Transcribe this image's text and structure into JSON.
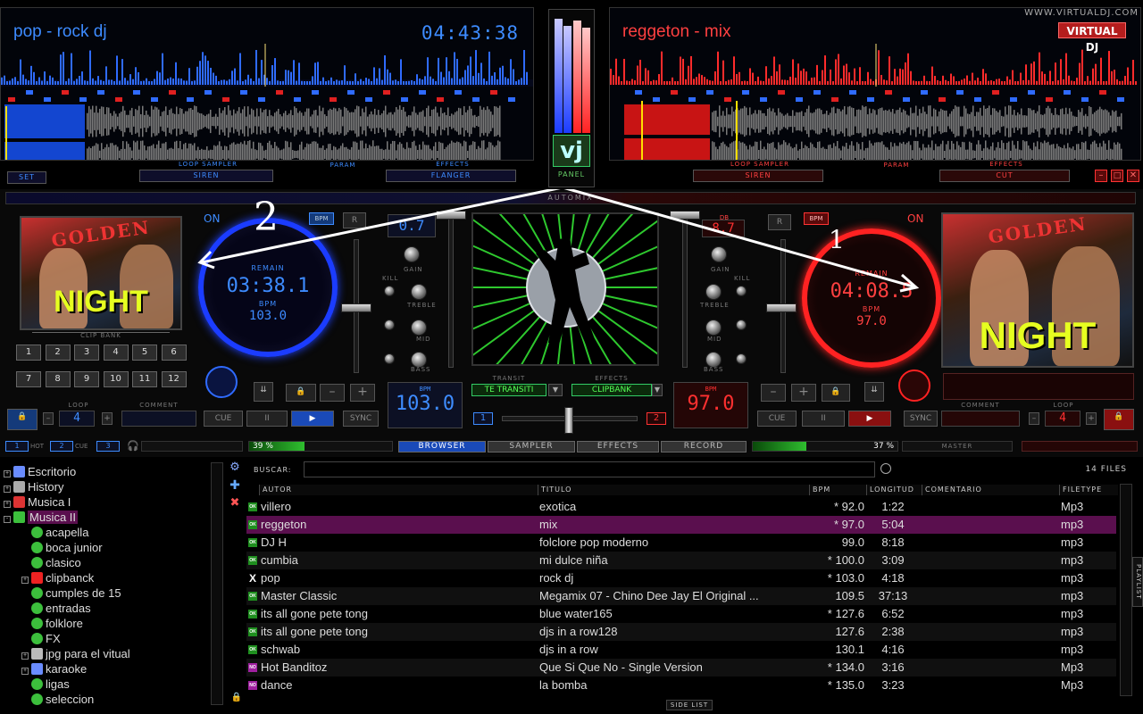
{
  "brand_text": "WWW.VIRTUALDJ.COM",
  "logo_text": "VIRTUAL DJ",
  "deck_left": {
    "title": "pop - rock dj",
    "clock": "04:43:38",
    "remain_label": "REMAIN",
    "remain_time": "03:38.1",
    "bpm_label": "BPM",
    "bpm_value": "103.0",
    "bpm_display": "103.0",
    "pitch": "0.7",
    "loop_sampler_label": "LOOP SAMPLER",
    "sampler_value": "SIREN",
    "param_label": "PARAM",
    "effects_label": "EFFECTS",
    "effect_value": "FLANGER",
    "set_label": "SET",
    "on_label": "ON",
    "clip_bank_label": "CLIP BANK",
    "clip_buttons": [
      "1",
      "2",
      "3",
      "4",
      "5",
      "6",
      "7",
      "8",
      "9",
      "10",
      "11",
      "12"
    ],
    "loop_label": "LOOP",
    "loop_value": "4",
    "comment_label": "COMMENT",
    "cue_label": "CUE",
    "pause_label": "II",
    "play_label": "▶",
    "sync_label": "SYNC",
    "hot_cue_1": "1",
    "hot_cue_2": "2",
    "hot_cue_3": "3",
    "cue_tag": "CUE",
    "hot_tag": "HOT",
    "volume_percent": "39 %",
    "volume_fraction": 0.39,
    "r_label": "R",
    "bpm_btn": "BPM"
  },
  "deck_right": {
    "title": "reggeton - mix",
    "remain_label": "REMAIN",
    "remain_time": "04:08.5",
    "bpm_label": "BPM",
    "bpm_value": "97.0",
    "bpm_display": "97.0",
    "pitch": "8.7",
    "loop_sampler_label": "LOOP SAMPLER",
    "sampler_value": "SIREN",
    "param_label": "PARAM",
    "effects_label": "EFFECTS",
    "effect_value": "CUT",
    "on_label": "ON",
    "loop_label": "LOOP",
    "loop_value": "4",
    "comment_label": "COMMENT",
    "cue_label": "CUE",
    "pause_label": "II",
    "play_label": "▶",
    "sync_label": "SYNC",
    "volume_percent": "37 %",
    "volume_fraction": 0.37,
    "r_label": "R",
    "bpm_btn": "BPM",
    "master_label": "MASTER"
  },
  "mixer": {
    "automix_label": "AUTOMIX",
    "gain": "GAIN",
    "kill": "KILL",
    "treble": "TREBLE",
    "mid": "MID",
    "bass": "BASS",
    "transition_label": "TRANSIT",
    "transition_value": "TE TRANSITI",
    "effects_label": "EFFECTS",
    "effects_value": "CLIPBANK",
    "cross_left": "1",
    "cross_right": "2",
    "panel_label": "PANEL",
    "vj_label": "vj",
    "db_label": "DB"
  },
  "annotations": {
    "one": "1",
    "two": "2"
  },
  "tabs": {
    "browser": "BROWSER",
    "sampler": "SAMPLER",
    "effects": "EFFECTS",
    "record": "RECORD"
  },
  "tree": [
    {
      "label": "Escritorio",
      "expander": "+",
      "indent": 0,
      "icon": "desktop-icon",
      "color": "#6a8cff"
    },
    {
      "label": "History",
      "expander": "+",
      "indent": 0,
      "icon": "history-icon",
      "color": "#aaaaaa"
    },
    {
      "label": "Musica I",
      "expander": "+",
      "indent": 0,
      "icon": "music-folder-icon",
      "color": "#d33"
    },
    {
      "label": "Musica II",
      "expander": "-",
      "indent": 0,
      "icon": "music-folder-icon",
      "color": "#3cbf3c",
      "selected": true
    },
    {
      "label": "acapella",
      "expander": "",
      "indent": 1,
      "icon": "play-folder-icon",
      "color": "#3cbf3c"
    },
    {
      "label": "boca junior",
      "expander": "",
      "indent": 1,
      "icon": "play-folder-icon",
      "color": "#3cbf3c"
    },
    {
      "label": "clasico",
      "expander": "",
      "indent": 1,
      "icon": "play-folder-icon",
      "color": "#3cbf3c"
    },
    {
      "label": "clipbanck",
      "expander": "+",
      "indent": 1,
      "icon": "forbidden-icon",
      "color": "#e22"
    },
    {
      "label": "cumples de 15",
      "expander": "",
      "indent": 1,
      "icon": "play-folder-icon",
      "color": "#3cbf3c"
    },
    {
      "label": "entradas",
      "expander": "",
      "indent": 1,
      "icon": "play-folder-icon",
      "color": "#3cbf3c"
    },
    {
      "label": "folklore",
      "expander": "",
      "indent": 1,
      "icon": "play-folder-icon",
      "color": "#3cbf3c"
    },
    {
      "label": "FX",
      "expander": "",
      "indent": 1,
      "icon": "play-folder-icon",
      "color": "#3cbf3c"
    },
    {
      "label": "jpg para el vitual",
      "expander": "+",
      "indent": 1,
      "icon": "camera-icon",
      "color": "#bbbbbb"
    },
    {
      "label": "karaoke",
      "expander": "+",
      "indent": 1,
      "icon": "note-icon",
      "color": "#6a8cff"
    },
    {
      "label": "ligas",
      "expander": "",
      "indent": 1,
      "icon": "play-folder-icon",
      "color": "#3cbf3c"
    },
    {
      "label": "seleccion",
      "expander": "",
      "indent": 1,
      "icon": "play-folder-icon",
      "color": "#3cbf3c"
    }
  ],
  "browser": {
    "search_label": "BUSCAR:",
    "search_value": "",
    "files_count": "14 FILES",
    "side_list": "SIDE LIST",
    "playlist_tab": "PLAYLIST",
    "columns": [
      "AUTOR",
      "TITULO",
      "BPM",
      "LONGITUD",
      "COMENTARIO",
      "FILETYPE"
    ],
    "rows": [
      {
        "badge": "OK",
        "autor": "villero",
        "titulo": "exotica",
        "bpm": "* 92.0",
        "longitud": "1:22",
        "comentario": "",
        "filetype": "Mp3"
      },
      {
        "badge": "OK",
        "autor": "reggeton",
        "titulo": "mix",
        "bpm": "* 97.0",
        "longitud": "5:04",
        "comentario": "",
        "filetype": "mp3",
        "highlight": "purple"
      },
      {
        "badge": "OK",
        "autor": "DJ H",
        "titulo": "folclore pop moderno",
        "bpm": "99.0",
        "longitud": "8:18",
        "comentario": "",
        "filetype": "mp3"
      },
      {
        "badge": "OK",
        "autor": "cumbia",
        "titulo": "mi dulce niña",
        "bpm": "* 100.0",
        "longitud": "3:09",
        "comentario": "",
        "filetype": "mp3"
      },
      {
        "badge": "X",
        "autor": "pop",
        "titulo": "rock dj",
        "bpm": "* 103.0",
        "longitud": "4:18",
        "comentario": "",
        "filetype": "mp3"
      },
      {
        "badge": "OK",
        "autor": "Master Classic",
        "titulo": "Megamix 07 - Chino Dee Jay El Original ...",
        "bpm": "109.5",
        "longitud": "37:13",
        "comentario": "",
        "filetype": "mp3"
      },
      {
        "badge": "OK",
        "autor": "its all gone pete tong",
        "titulo": "blue water165",
        "bpm": "* 127.6",
        "longitud": "6:52",
        "comentario": "",
        "filetype": "mp3"
      },
      {
        "badge": "OK",
        "autor": "its all gone pete tong",
        "titulo": "djs in a row128",
        "bpm": "127.6",
        "longitud": "2:38",
        "comentario": "",
        "filetype": "mp3"
      },
      {
        "badge": "OK",
        "autor": "schwab",
        "titulo": "djs in a row",
        "bpm": "130.1",
        "longitud": "4:16",
        "comentario": "",
        "filetype": "mp3"
      },
      {
        "badge": "NO",
        "autor": "Hot Banditoz",
        "titulo": "Que Si Que No - Single Version",
        "bpm": "* 134.0",
        "longitud": "3:16",
        "comentario": "",
        "filetype": "Mp3"
      },
      {
        "badge": "NO",
        "autor": "dance",
        "titulo": "la bomba",
        "bpm": "* 135.0",
        "longitud": "3:23",
        "comentario": "",
        "filetype": "Mp3"
      }
    ]
  },
  "colors": {
    "deck_left": "#2f6bff",
    "deck_right": "#ff2b2b",
    "highlight_row": "#5a0f4e",
    "ok_badge": "#1f8f1f",
    "no_badge": "#a020a0"
  }
}
